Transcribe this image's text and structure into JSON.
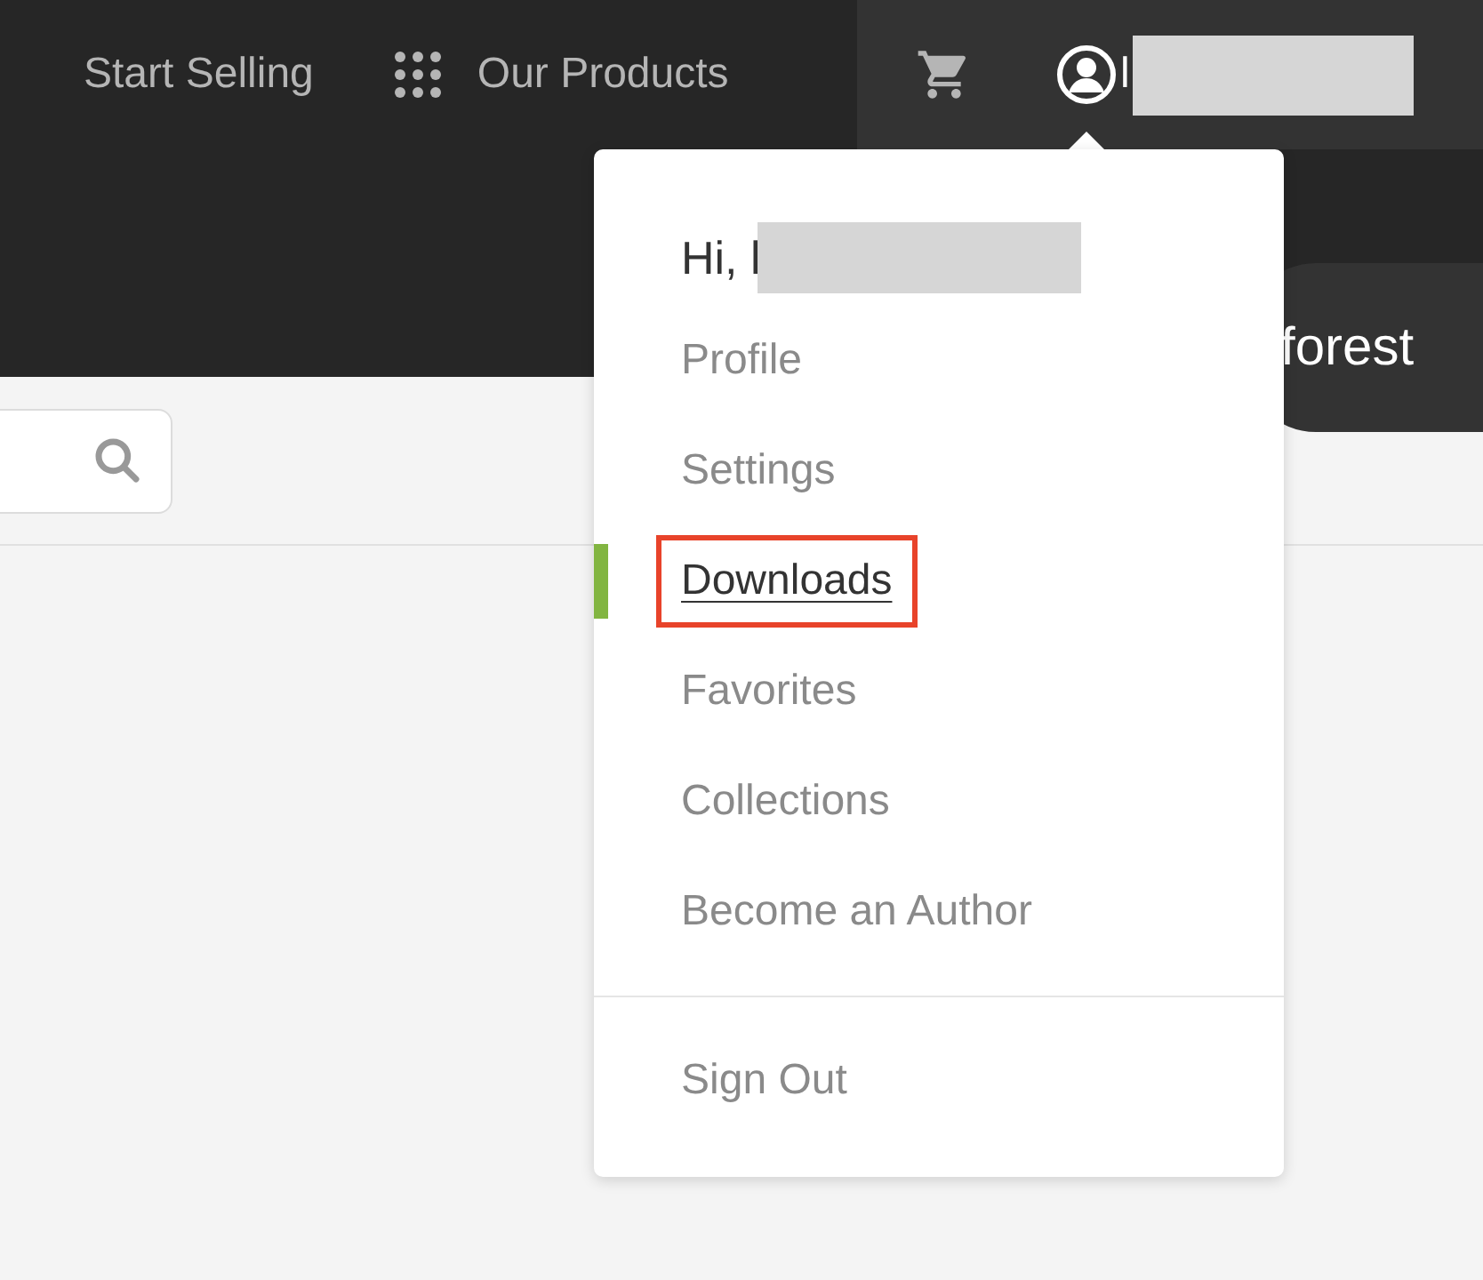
{
  "nav": {
    "items": [
      {
        "label": "Start Selling",
        "kind": "text"
      },
      {
        "label": "Our Products",
        "kind": "grid"
      }
    ],
    "user_name": "l"
  },
  "brand": {
    "label": "forest"
  },
  "menu": {
    "greeting": "Hi, l",
    "items": [
      {
        "label": "Profile",
        "selected": false,
        "highlighted": false
      },
      {
        "label": "Settings",
        "selected": false,
        "highlighted": false
      },
      {
        "label": "Downloads",
        "selected": true,
        "highlighted": true
      },
      {
        "label": "Favorites",
        "selected": false,
        "highlighted": false
      },
      {
        "label": "Collections",
        "selected": false,
        "highlighted": false
      },
      {
        "label": "Become an Author",
        "selected": false,
        "highlighted": false
      }
    ],
    "footer_items": [
      {
        "label": "Sign Out",
        "selected": false,
        "highlighted": false
      }
    ]
  }
}
